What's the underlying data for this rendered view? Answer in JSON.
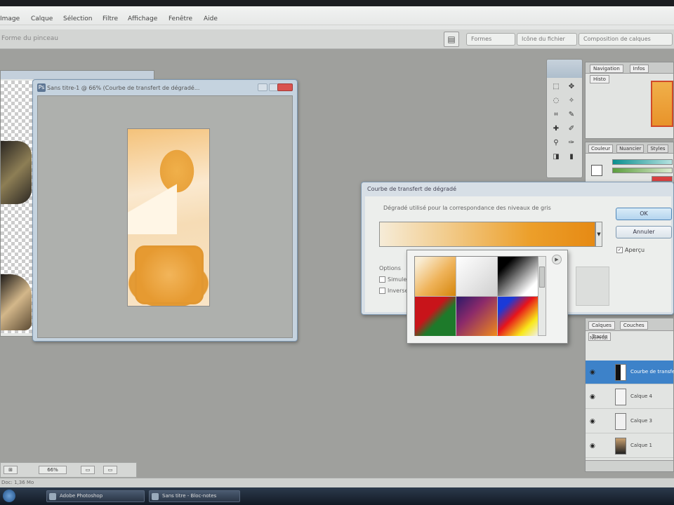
{
  "menubar": {
    "items": [
      "Image",
      "Calque",
      "Sélection",
      "Filtre",
      "Affichage",
      "Fenêtre",
      "Aide"
    ]
  },
  "optionsbar": {
    "left_text": "Forme du pinceau",
    "field1": "Formes",
    "field2": "Icône du fichier",
    "field3": "Composition de calques"
  },
  "preview_window": {
    "title": "Sans titre-1 @ 66% (Courbe de transfert de dégradé..."
  },
  "gradient_map_dialog": {
    "title": "Courbe de transfert de dégradé",
    "group_label": "Dégradé utilisé pour la correspondance des niveaux de gris",
    "options_label": "Options",
    "option1": "Simuler",
    "option2": "Inverser",
    "ok_label": "OK",
    "cancel_label": "Annuler",
    "preview_label": "Aperçu"
  },
  "swatch_picker": {
    "swatches": [
      "linear-gradient(135deg, #f9edd5 10%, #efb35a 55%, #d5860c 100%)",
      "linear-gradient(135deg, #ffffff 0%, #e8e8e8 50%, #cfcfcf 100%)",
      "linear-gradient(135deg, #000000 20%, #ffffff 80%)",
      "linear-gradient(135deg, #c8141a 40%, #1d7a2a 60%)",
      "linear-gradient(135deg, #2b1a6a 0%, #8b2a6a 40%, #f08a1a 100%)",
      "linear-gradient(135deg, #1a3ad8 20%, #e8141a 45%, #f8e81a 75%, #f0f0f0 100%)"
    ]
  },
  "navigator": {
    "tabs": [
      "Navigation",
      "Infos",
      "Histo"
    ]
  },
  "color_panel": {
    "tabs": [
      "Couleur",
      "Nuancier",
      "Styles"
    ]
  },
  "layers": {
    "tabs": [
      "Calques",
      "Couches",
      "Tracés"
    ],
    "blend_label": "Normal",
    "rows": [
      {
        "name": "Courbe de transfert",
        "selected": true
      },
      {
        "name": "Calque 4",
        "selected": false
      },
      {
        "name": "Calque 3",
        "selected": false
      },
      {
        "name": "Calque 1",
        "selected": false
      }
    ]
  },
  "status": {
    "zoom_label": "66%",
    "doc_text": "Doc: 1,36 Mo"
  },
  "taskbar": {
    "buttons": [
      "Adobe Photoshop",
      "Sans titre - Bloc-notes"
    ]
  }
}
